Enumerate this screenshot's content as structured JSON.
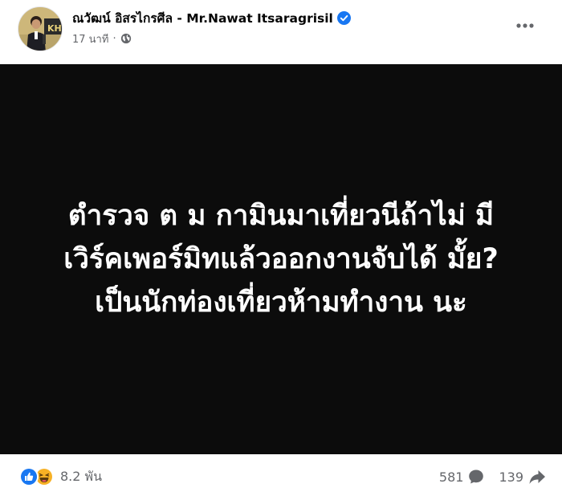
{
  "post": {
    "author_name": "ณวัฒน์ อิสรไกรศีล - Mr.Nawat Itsaragrisil",
    "verified_icon": "verified-badge-icon",
    "timestamp": "17 นาที",
    "separator": "·",
    "audience_icon": "globe-icon",
    "more_icon": "more-options-icon",
    "image_text": "ตำรวจ ต ม กามินมาเที่ยวนีถ้าไม่ มีเวิร์คเพอร์มิทแล้วออกงานจับได้ มั้ย? เป็นนักท่องเที่ยวห้ามทำงาน นะ",
    "image_background": "#0c0c0c"
  },
  "reactions": {
    "types": [
      "like-icon",
      "haha-icon"
    ],
    "count": "8.2 พัน"
  },
  "stats": {
    "comments": "581",
    "comment_icon": "comment-icon",
    "shares": "139",
    "share_icon": "share-icon"
  },
  "colors": {
    "verified_blue": "#1877f2",
    "secondary_text": "#65676b",
    "like_blue": "#1877f2",
    "haha_yellow": "#f7b125"
  }
}
